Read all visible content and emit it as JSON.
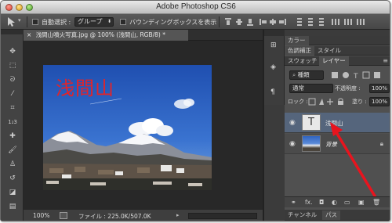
{
  "window": {
    "title": "Adobe Photoshop CS6"
  },
  "options_bar": {
    "auto_select_label": "自動選択 :",
    "auto_select_value": "グループ",
    "bounding_box_label": "バウンディングボックスを表示"
  },
  "document": {
    "tab_title": "浅間山噴火写真.jpg @ 100% (浅間山, RGB/8) *",
    "close_glyph": "×",
    "overlay_text": "浅間山",
    "zoom": "100%",
    "file_info": "ファイル : 225.0K/507.0K"
  },
  "panels": {
    "color_tab": "カラー",
    "adjust_tab": "色調補正",
    "style_tab": "スタイル",
    "swatch_tab": "スウォッチ",
    "layers_tab": "レイヤー",
    "filter_kind": "種類",
    "blend_mode": "通常",
    "opacity_label": "不透明度 :",
    "opacity_value": "100%",
    "lock_label": "ロック :",
    "fill_label": "塗り :",
    "fill_value": "100%",
    "layers": [
      {
        "name": "浅間山",
        "type": "text",
        "thumb_glyph": "T"
      },
      {
        "name": "背景",
        "type": "image"
      }
    ],
    "channels_tab": "チャンネル",
    "paths_tab": "パス",
    "footer_fx": "fx."
  },
  "colors": {
    "accent_arrow": "#e8141e",
    "selected_layer": "#55657c",
    "overlay_text": "#e2242a"
  }
}
